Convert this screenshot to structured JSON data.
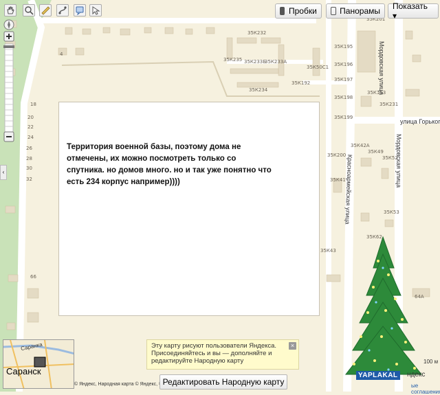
{
  "toolbar": {
    "tools": [
      "hand-icon",
      "zoom-icon",
      "ruler-icon",
      "route-icon",
      "bubble-icon",
      "pointer-icon"
    ],
    "traffic_label": "Пробки",
    "panoramas_label": "Панорамы",
    "show_label": "Показать ▾"
  },
  "map": {
    "annotation": "Территория военной базы, поэтому дома не отмечены, их можно посмотреть только со спутника. но домов много. но и так уже понятно что есть 234 корпус например))))",
    "streets": {
      "mordovskaya_top": "Мордовская улица",
      "mordovskaya_bottom": "Мордовская улица",
      "gorkogo": "улица Горького",
      "krasnoarmeyskaya": "Красноармейская улица"
    },
    "building_labels": [
      "35К201",
      "35К232",
      "35К235",
      "35К233Б",
      "35К233А",
      "35К195",
      "35К196",
      "35К50С1",
      "35К197",
      "35К192",
      "35К234",
      "35К153",
      "35К198",
      "35К231",
      "35К199",
      "35К42А",
      "35К200",
      "35К49",
      "35К52",
      "35К41",
      "35К53",
      "35К62",
      "35К43",
      "64А"
    ],
    "house_numbers": [
      "4",
      "18",
      "20",
      "22",
      "24",
      "26",
      "28",
      "30",
      "32",
      "66"
    ]
  },
  "minimap": {
    "city": "Саранск",
    "top_label": "Саранка"
  },
  "promo": {
    "text": "Эту карту рисуют пользователи Яндекса. Присоединяйтесь и вы — дополняйте и редактируйте Народную карту"
  },
  "edit_button": "Редактировать Народную карту",
  "footer": {
    "copyright": "© Яндекс, Народная карта © Яндекс, © «СКАНЭКС», © GeoEye,",
    "scale": "100 м",
    "watermark": "YAPLAKAL",
    "watermark_suffix": "ндекс",
    "terms": "ые соглашения"
  },
  "colors": {
    "map_bg": "#f6f1df",
    "road": "#ffffff",
    "building": "#e4dbc4",
    "park": "#c9e2b8",
    "tree": "#2d8a3a"
  }
}
